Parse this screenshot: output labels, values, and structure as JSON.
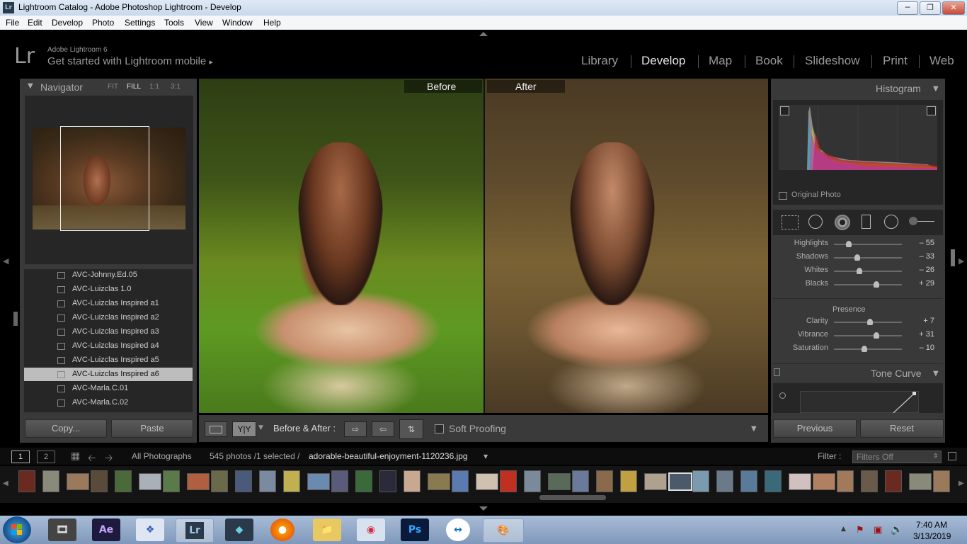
{
  "window": {
    "title": "Lightroom Catalog - Adobe Photoshop Lightroom - Develop",
    "icon_text": "Lr"
  },
  "menu": [
    "File",
    "Edit",
    "Develop",
    "Photo",
    "Settings",
    "Tools",
    "View",
    "Window",
    "Help"
  ],
  "identity": {
    "logo": "Lr",
    "product": "Adobe Lightroom 6",
    "tagline": "Get started with Lightroom mobile",
    "arrow": "▸"
  },
  "modules": [
    {
      "label": "Library",
      "active": false
    },
    {
      "label": "Develop",
      "active": true
    },
    {
      "label": "Map",
      "active": false
    },
    {
      "label": "Book",
      "active": false
    },
    {
      "label": "Slideshow",
      "active": false
    },
    {
      "label": "Print",
      "active": false
    },
    {
      "label": "Web",
      "active": false
    }
  ],
  "navigator": {
    "title": "Navigator",
    "zoom_options": [
      "FIT",
      "FILL",
      "1:1",
      "3:1"
    ],
    "active_zoom": "FILL"
  },
  "presets": [
    {
      "label": "AVC-Johnny.Ed.05",
      "selected": false
    },
    {
      "label": "AVC-Luizclas 1.0",
      "selected": false
    },
    {
      "label": "AVC-Luizclas Inspired a1",
      "selected": false
    },
    {
      "label": "AVC-Luizclas Inspired a2",
      "selected": false
    },
    {
      "label": "AVC-Luizclas Inspired a3",
      "selected": false
    },
    {
      "label": "AVC-Luizclas Inspired a4",
      "selected": false
    },
    {
      "label": "AVC-Luizclas Inspired a5",
      "selected": false
    },
    {
      "label": "AVC-Luizclas Inspired a6",
      "selected": true
    },
    {
      "label": "AVC-Marla.C.01",
      "selected": false
    },
    {
      "label": "AVC-Marla.C.02",
      "selected": false
    }
  ],
  "left_buttons": {
    "copy": "Copy...",
    "paste": "Paste"
  },
  "view": {
    "before_label": "Before",
    "after_label": "After"
  },
  "toolbar": {
    "yy": "Y|Y",
    "before_after": "Before & After :",
    "soft_proofing": "Soft Proofing"
  },
  "histogram": {
    "title": "Histogram",
    "original_photo": "Original Photo"
  },
  "tone": [
    {
      "label": "Highlights",
      "value": "– 55",
      "pos": 0.22
    },
    {
      "label": "Shadows",
      "value": "– 33",
      "pos": 0.34
    },
    {
      "label": "Whites",
      "value": "– 26",
      "pos": 0.38
    },
    {
      "label": "Blacks",
      "value": "+ 29",
      "pos": 0.63
    }
  ],
  "presence": {
    "title": "Presence",
    "sliders": [
      {
        "label": "Clarity",
        "value": "+ 7",
        "pos": 0.53
      },
      {
        "label": "Vibrance",
        "value": "+ 31",
        "pos": 0.63
      },
      {
        "label": "Saturation",
        "value": "– 10",
        "pos": 0.45
      }
    ]
  },
  "tone_curve": {
    "title": "Tone Curve"
  },
  "right_buttons": {
    "previous": "Previous",
    "reset": "Reset"
  },
  "filmstrip": {
    "page1": "1",
    "page2": "2",
    "source": "All Photographs",
    "count": "545 photos /1 selected /",
    "filename": "adorable-beautiful-enjoyment-1120236.jpg",
    "filter_label": "Filter :",
    "filter_value": "Filters Off"
  },
  "taskbar": {
    "time": "7:40 AM",
    "date": "3/13/2019"
  },
  "colors": {
    "accent": "#e6e6e6",
    "panel": "#393939",
    "background": "#000000"
  }
}
